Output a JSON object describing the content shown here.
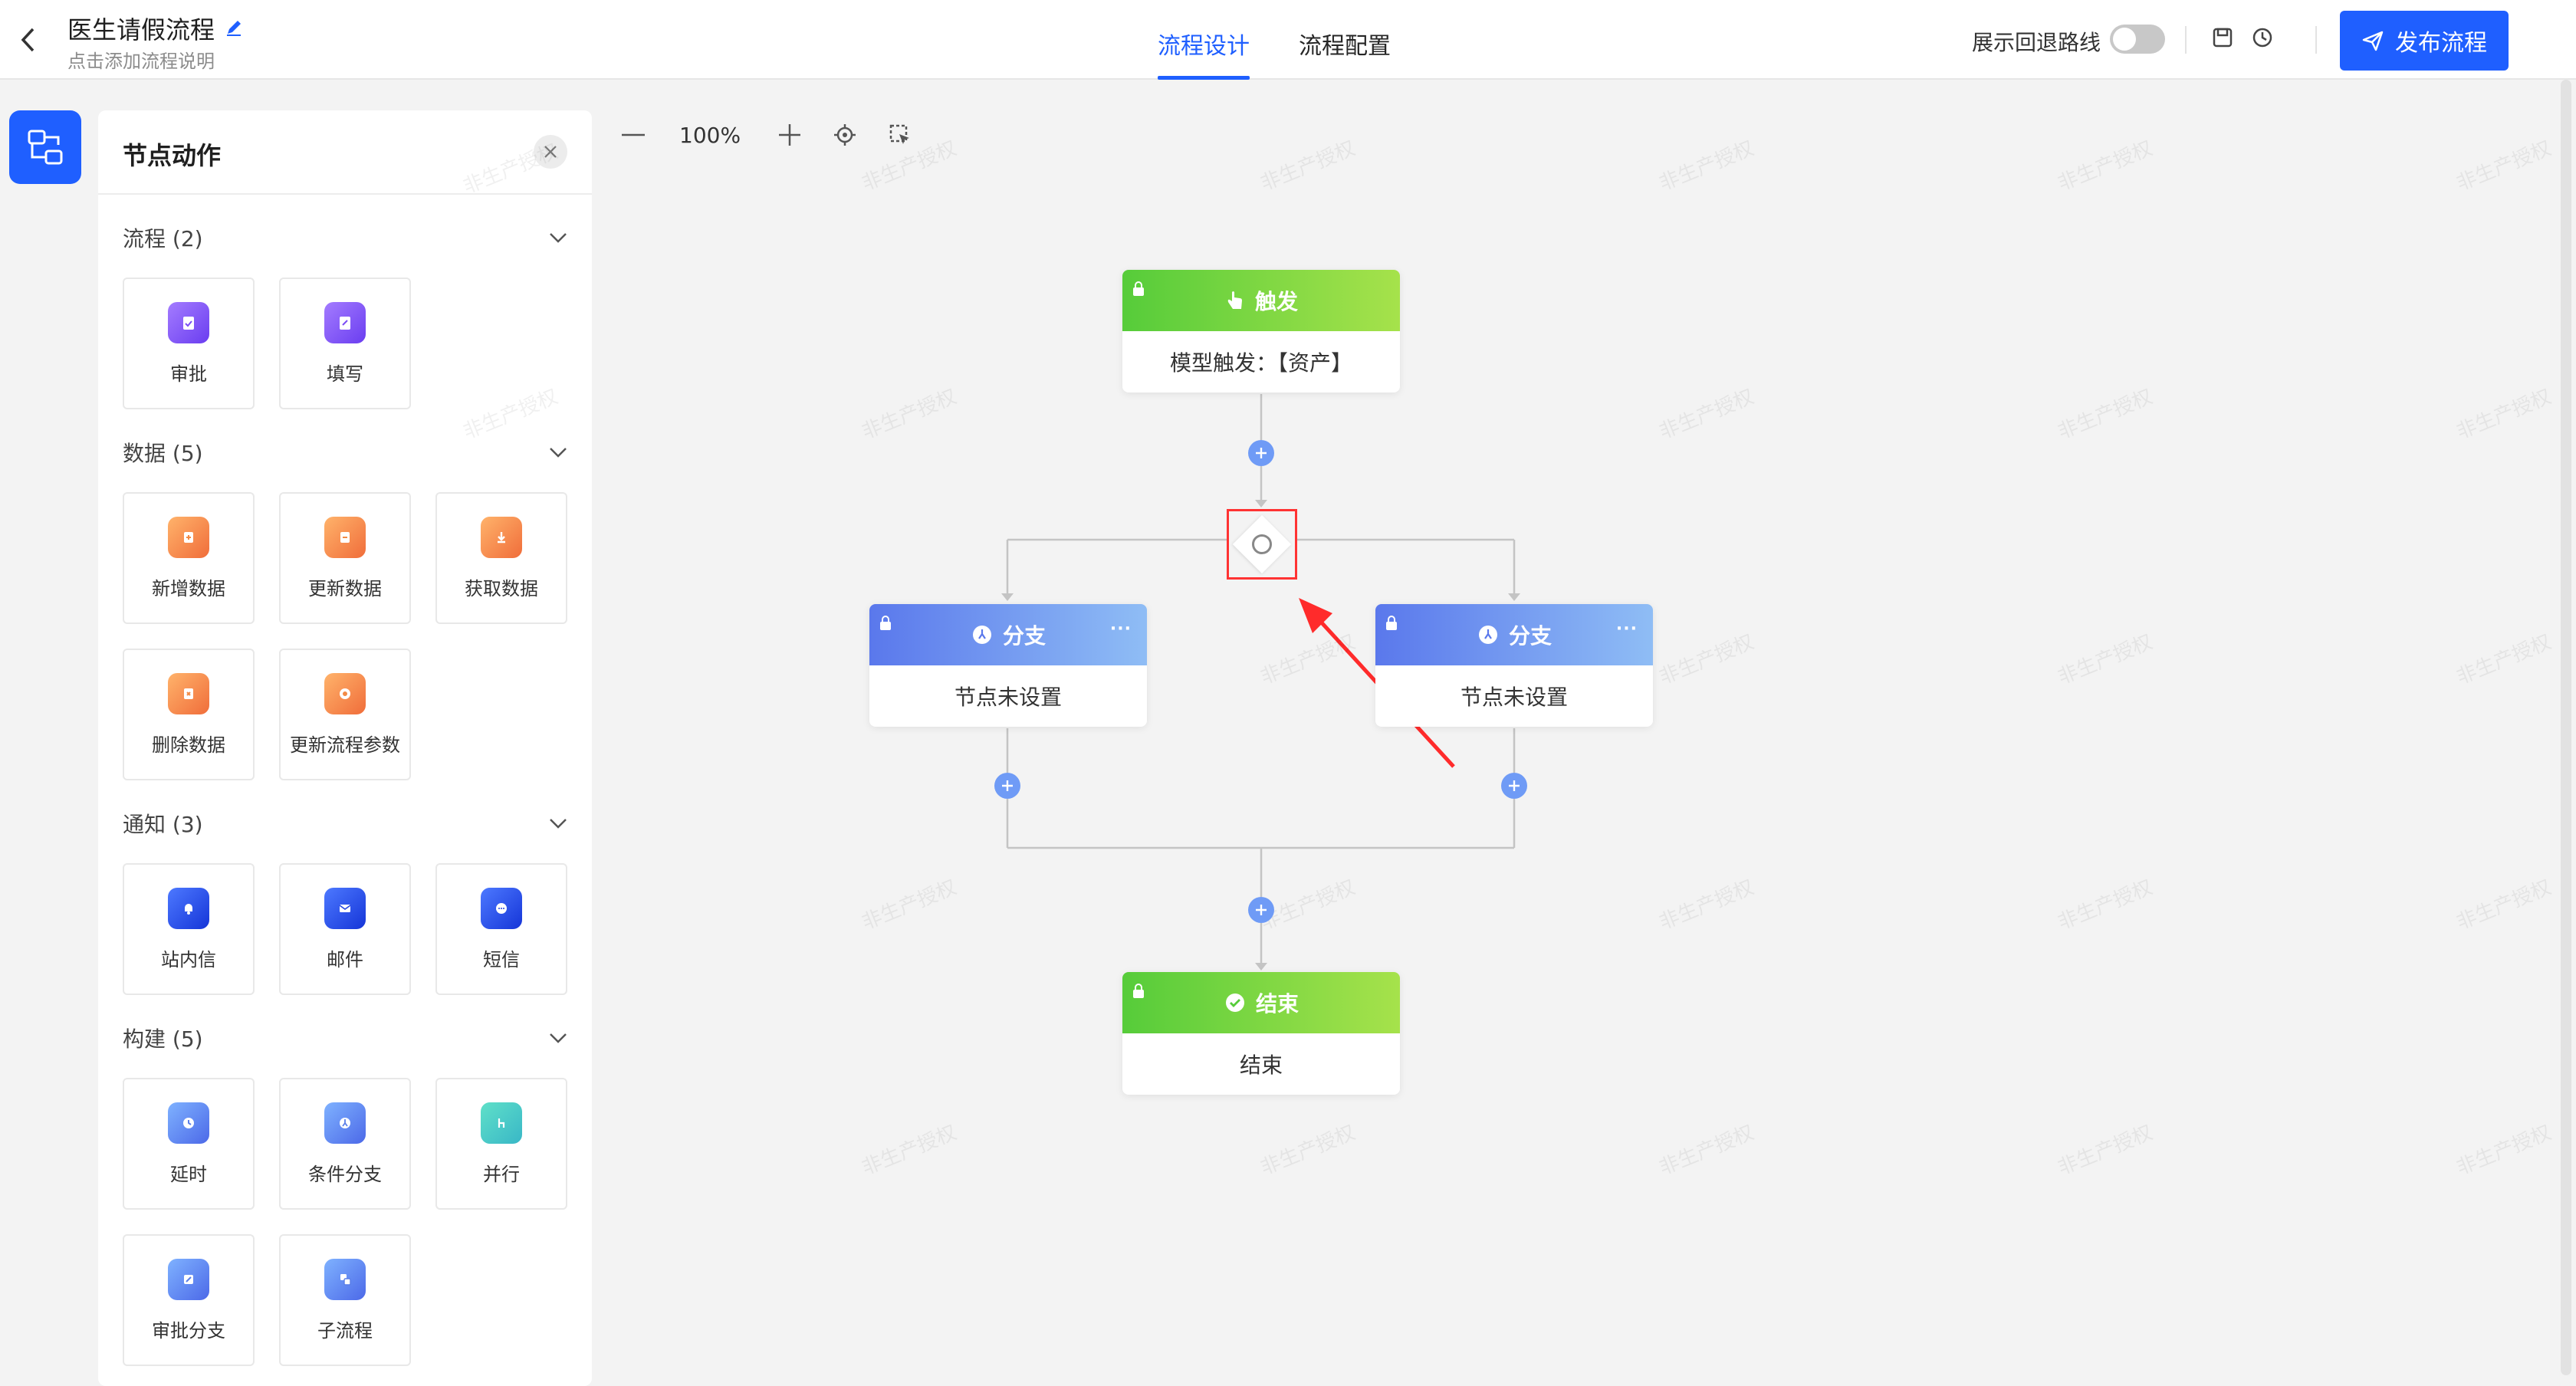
{
  "header": {
    "title": "医生请假流程",
    "subtitle": "点击添加流程说明",
    "tabs": [
      {
        "label": "流程设计",
        "active": true
      },
      {
        "label": "流程配置",
        "active": false
      }
    ],
    "rollback_label": "展示回退路线",
    "rollback_enabled": false,
    "publish_label": "发布流程"
  },
  "panel": {
    "title": "节点动作",
    "sections": [
      {
        "label": "流程 (2)",
        "items": [
          "审批",
          "填写"
        ]
      },
      {
        "label": "数据 (5)",
        "items": [
          "新增数据",
          "更新数据",
          "获取数据",
          "删除数据",
          "更新流程参数"
        ]
      },
      {
        "label": "通知 (3)",
        "items": [
          "站内信",
          "邮件",
          "短信"
        ]
      },
      {
        "label": "构建 (5)",
        "items": [
          "延时",
          "条件分支",
          "并行",
          "审批分支",
          "子流程"
        ]
      }
    ]
  },
  "toolbar": {
    "zoom": "100%"
  },
  "flow": {
    "trigger": {
      "title": "触发",
      "body": "模型触发：【资产】"
    },
    "branch_left": {
      "title": "分支",
      "body": "节点未设置"
    },
    "branch_right": {
      "title": "分支",
      "body": "节点未设置"
    },
    "end": {
      "title": "结束",
      "body": "结束"
    }
  },
  "watermark": "非生产授权",
  "colors": {
    "accent": "#1f5fff",
    "trigger_green": "#56cc3a",
    "branch_blue": "#5a78ec",
    "highlight_red": "#ff3333"
  }
}
